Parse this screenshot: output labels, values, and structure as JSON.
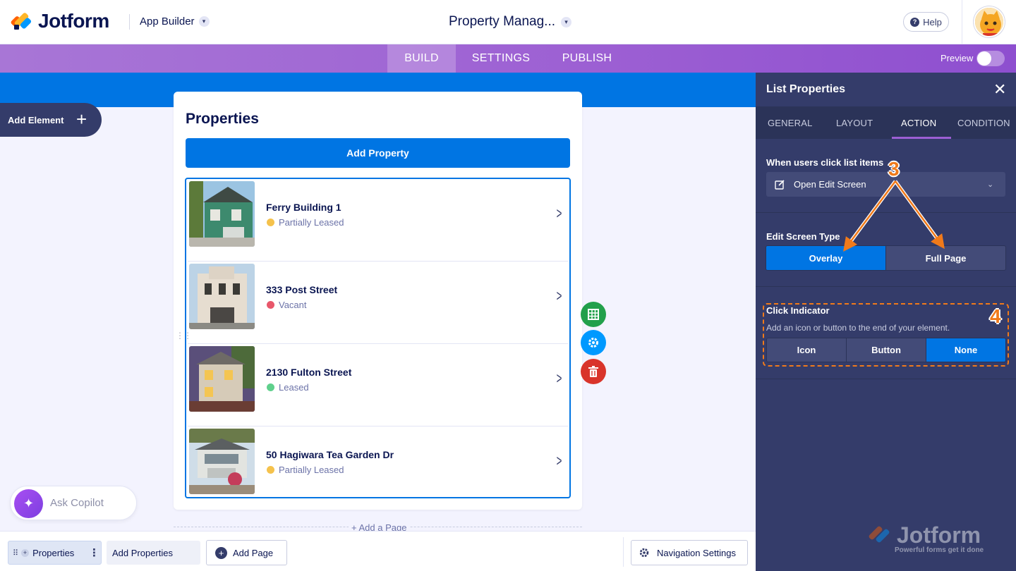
{
  "header": {
    "brand": "Jotform",
    "app_builder": "App Builder",
    "app_title": "Property Manag...",
    "help": "Help"
  },
  "nav": {
    "tabs": [
      {
        "label": "BUILD"
      },
      {
        "label": "SETTINGS"
      },
      {
        "label": "PUBLISH"
      }
    ],
    "active_tab": "BUILD",
    "preview_label": "Preview",
    "preview_on": false
  },
  "canvas": {
    "add_element": "Add Element",
    "card_title": "Properties",
    "add_button": "Add Property",
    "items": [
      {
        "name": "Ferry Building 1",
        "status": "Partially Leased",
        "status_color": "#f5c24c"
      },
      {
        "name": "333 Post Street",
        "status": "Vacant",
        "status_color": "#e8576b"
      },
      {
        "name": "2130 Fulton Street",
        "status": "Leased",
        "status_color": "#5fd08c"
      },
      {
        "name": "50 Hagiwara Tea Garden Dr",
        "status": "Partially Leased",
        "status_color": "#f5c24c"
      }
    ],
    "add_page": "+ Add a Page",
    "copilot": "Ask Copilot"
  },
  "bottom": {
    "properties": "Properties",
    "add_properties": "Add Properties",
    "add_page": "Add Page",
    "nav_settings": "Navigation Settings"
  },
  "panel": {
    "title": "List Properties",
    "tabs": [
      {
        "label": "GENERAL"
      },
      {
        "label": "LAYOUT"
      },
      {
        "label": "ACTION"
      },
      {
        "label": "CONDITION"
      }
    ],
    "active_tab": "ACTION",
    "click_label": "When users click list items",
    "click_value": "Open Edit Screen",
    "edit_type_label": "Edit Screen Type",
    "edit_type_options": [
      "Overlay",
      "Full Page"
    ],
    "edit_type_selected": "Overlay",
    "indicator_label": "Click Indicator",
    "indicator_desc": "Add an icon or button to the end of your element.",
    "indicator_options": [
      "Icon",
      "Button",
      "None"
    ],
    "indicator_selected": "None",
    "badge_3": "3",
    "badge_4": "4",
    "watermark": "Jotform",
    "watermark_tag": "Powerful forms get it done"
  },
  "colors": {
    "accent": "#0075e3",
    "purple": "#9c5fd3",
    "panel": "#343c6a",
    "annotation": "#f07a1a"
  }
}
